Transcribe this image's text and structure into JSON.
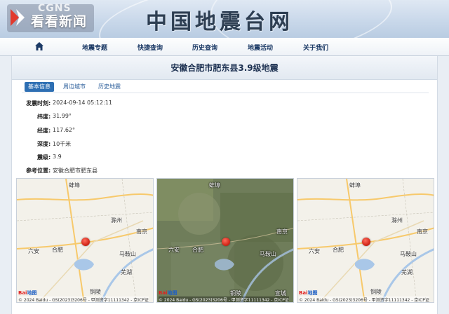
{
  "watermark": {
    "logo_text": "CGNS",
    "text": "看看新闻"
  },
  "site_title": "中国地震台网",
  "nav": {
    "items": [
      {
        "label": "地震专题"
      },
      {
        "label": "快捷查询"
      },
      {
        "label": "历史查询"
      },
      {
        "label": "地震活动"
      },
      {
        "label": "关于我们"
      }
    ]
  },
  "page": {
    "title": "安徽合肥市肥东县3.9级地震"
  },
  "tabs": [
    {
      "label": "基本信息",
      "active": true
    },
    {
      "label": "周边城市",
      "active": false
    },
    {
      "label": "历史地震",
      "active": false
    }
  ],
  "details": [
    {
      "label": "发震时刻:",
      "value": "2024-09-14 05:12:11"
    },
    {
      "label": "纬度:",
      "value": "31.99°"
    },
    {
      "label": "经度:",
      "value": "117.62°"
    },
    {
      "label": "深度:",
      "value": "10千米"
    },
    {
      "label": "震级:",
      "value": "3.9"
    },
    {
      "label": "参考位置:",
      "value": "安徽合肥市肥东县"
    }
  ],
  "maps": [
    {
      "type": "road",
      "cities": [
        "蚌埠",
        "滁州",
        "南京",
        "六安",
        "合肥",
        "马鞍山",
        "芜湖",
        "铜陵"
      ],
      "copyright": "© 2024 Baidu - GS(2023)3206号 - 甲测资字11111342 - 京ICP证"
    },
    {
      "type": "satellite",
      "cities": [
        "蚌埠",
        "南京",
        "六安",
        "合肥",
        "马鞍山",
        "铜陵",
        "宣城"
      ],
      "copyright": "© 2024 Baidu - GS(2023)3206号 - 甲测资字11111342 - 京ICP证"
    },
    {
      "type": "road",
      "cities": [
        "蚌埠",
        "滁州",
        "南京",
        "六安",
        "合肥",
        "马鞍山",
        "芜湖",
        "铜陵"
      ],
      "copyright": "© 2024 Baidu - GS(2023)3206号 - 甲测资字11111342 - 京ICP证"
    }
  ],
  "map_brand": {
    "part1": "Bai",
    "part2": "地图"
  },
  "colors": {
    "nav_text": "#1c3a66",
    "tab_active": "#2e6fb3",
    "epicenter": "#d42a1c",
    "title": "#1e3252"
  }
}
